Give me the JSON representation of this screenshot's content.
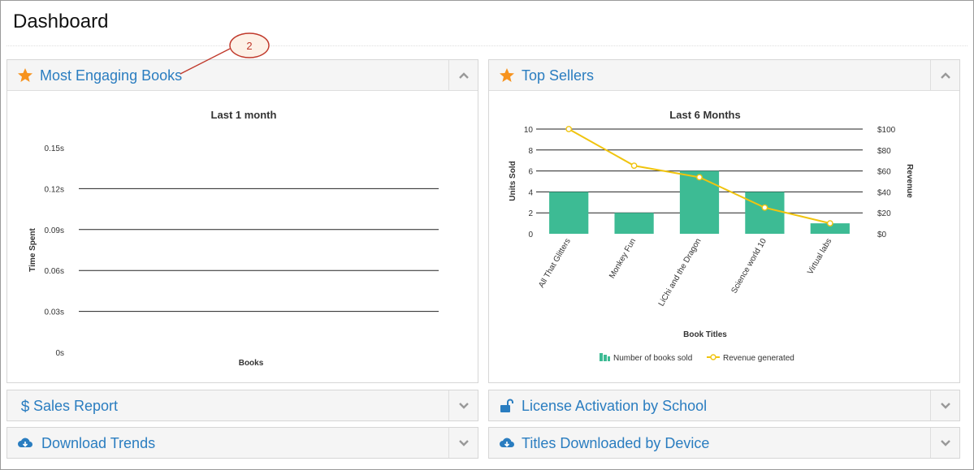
{
  "page": {
    "title": "Dashboard"
  },
  "callout": {
    "number": "2"
  },
  "panels": {
    "engaging": {
      "title": "Most Engaging Books",
      "icon": "star-icon",
      "toggle": "chevron-up-icon"
    },
    "top_sellers": {
      "title": "Top Sellers",
      "icon": "star-icon",
      "toggle": "chevron-up-icon"
    },
    "sales": {
      "title": "Sales Report",
      "icon": "dollar-icon",
      "toggle": "chevron-down-icon"
    },
    "license": {
      "title": "License Activation by School",
      "icon": "unlock-icon",
      "toggle": "chevron-down-icon"
    },
    "downloads": {
      "title": "Download Trends",
      "icon": "cloud-download-icon",
      "toggle": "chevron-down-icon"
    },
    "devices": {
      "title": "Titles Downloaded by Device",
      "icon": "cloud-download-icon",
      "toggle": "chevron-down-icon"
    }
  },
  "colors": {
    "accent": "#2a7dc0",
    "star": "#f7931e",
    "bar": "#3dbb94",
    "line": "#f0c40f"
  },
  "chart_data": [
    {
      "type": "bar",
      "title": "Last 1 month",
      "xlabel": "Books",
      "ylabel": "Time Spent",
      "ylim": [
        0,
        0.15
      ],
      "yticks": [
        "0s",
        "0.03s",
        "0.06s",
        "0.09s",
        "0.12s",
        "0.15s"
      ],
      "categories": [],
      "values": [],
      "grid": true
    },
    {
      "type": "bar",
      "title": "Last 6 Months",
      "xlabel": "Book Titles",
      "ylabel": "Units Sold",
      "y2label": "Revenue",
      "ylim": [
        0,
        10
      ],
      "y2lim": [
        0,
        100
      ],
      "yticks": [
        "0",
        "2",
        "4",
        "6",
        "8",
        "10"
      ],
      "y2ticks": [
        "$0",
        "$20",
        "$40",
        "$60",
        "$80",
        "$100"
      ],
      "categories": [
        "All That Glitters",
        "Monkey Fun",
        "LiChi and the Dragon",
        "Science world 10",
        "Virtual labs"
      ],
      "series": [
        {
          "name": "Number of books sold",
          "type": "bar",
          "axis": "left",
          "values": [
            4,
            2,
            6,
            4,
            1
          ]
        },
        {
          "name": "Revenue generated",
          "type": "line",
          "axis": "right",
          "values": [
            100,
            65,
            54,
            25,
            10
          ]
        }
      ],
      "legend": "bottom",
      "grid": true
    }
  ]
}
